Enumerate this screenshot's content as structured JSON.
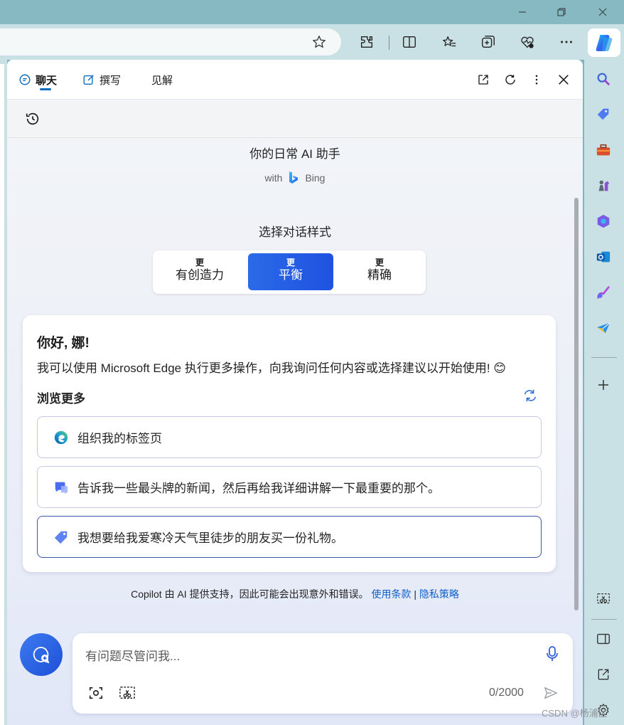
{
  "window": {
    "minimize_icon": "minimize-icon",
    "restore_icon": "restore-icon",
    "close_icon": "close-icon"
  },
  "toolbar": {
    "favorite_icon": "star-icon",
    "icons": [
      "extensions-icon",
      "split-screen-icon",
      "favorites-icon",
      "collections-icon",
      "browser-essentials-icon",
      "more-icon",
      "copilot-icon"
    ]
  },
  "panel": {
    "tabs": [
      {
        "label": "聊天",
        "icon": "chat-icon"
      },
      {
        "label": "撰写",
        "icon": "compose-icon"
      },
      {
        "label": "见解",
        "icon": ""
      }
    ],
    "header_icons": [
      "open-in-new-icon",
      "refresh-icon",
      "more-vertical-icon",
      "close-icon"
    ]
  },
  "welcome": {
    "subtitle": "你的日常 AI 助手",
    "with": "with",
    "bing": "Bing"
  },
  "conversation_style": {
    "title": "选择对话样式",
    "options": [
      {
        "small": "更",
        "big": "有创造力"
      },
      {
        "small": "更",
        "big": "平衡"
      },
      {
        "small": "更",
        "big": "精确"
      }
    ],
    "selected": "平衡"
  },
  "card": {
    "greeting": "你好, 娜!",
    "intro": "我可以使用 Microsoft Edge 执行更多操作，向我询问任何内容或选择建议以开始使用! 😊",
    "browse_title": "浏览更多",
    "suggestions": [
      {
        "text": "组织我的标签页",
        "icon": "edge-icon"
      },
      {
        "text": "告诉我一些最头牌的新闻，然后再给我详细讲解一下最重要的那个。",
        "icon": "news-chat-icon"
      },
      {
        "text": "我想要给我爱寒冷天气里徒步的朋友买一份礼物。",
        "icon": "shopping-tag-icon"
      }
    ]
  },
  "disclaimer": {
    "text": "Copilot 由 AI 提供支持，因此可能会出现意外和错误。",
    "terms": "使用条款",
    "separator": "|",
    "privacy": "隐私策略"
  },
  "input": {
    "placeholder": "有问题尽管问我...",
    "counter": "0/2000"
  },
  "watermark": "CSDN @杨浦区",
  "colors": {
    "accent": "#1f52e0",
    "link": "#0f5fc9",
    "frame": "#c9e0e4",
    "titlebar": "#86b9c2"
  }
}
